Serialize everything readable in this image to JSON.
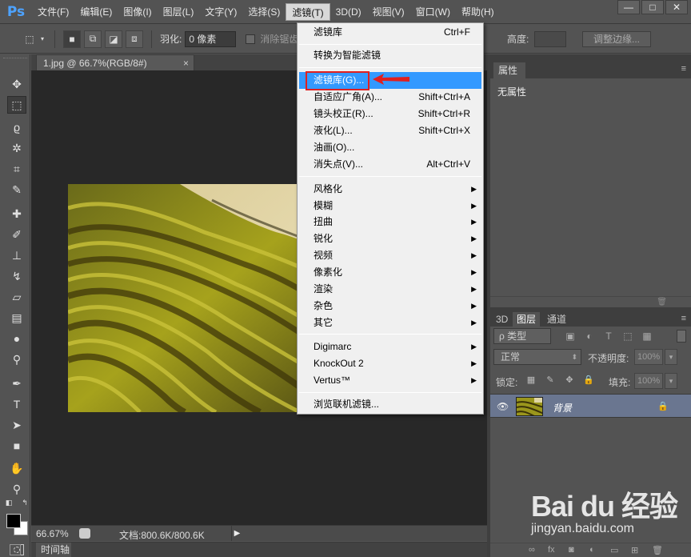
{
  "app": {
    "logo": "Ps"
  },
  "menubar": {
    "items": [
      "文件(F)",
      "编辑(E)",
      "图像(I)",
      "图层(L)",
      "文字(Y)",
      "选择(S)",
      "滤镜(T)",
      "3D(D)",
      "视图(V)",
      "窗口(W)",
      "帮助(H)"
    ],
    "active_index": 6,
    "window_controls": [
      "—",
      "□",
      "✕"
    ]
  },
  "options": {
    "feather_label": "羽化:",
    "feather_value": "0 像素",
    "antialias_label": "消除锯齿",
    "height_label": "高度:",
    "refine_edge": "调整边缘..."
  },
  "document": {
    "tab_title": "1.jpg @ 66.7%(RGB/8#)",
    "tab_close": "×",
    "zoom": "66.67%",
    "doc_info": "文档:800.6K/800.6K",
    "timeline_tab": "时间轴"
  },
  "filter_menu": {
    "items": [
      {
        "label": "滤镜库",
        "shortcut": "Ctrl+F"
      },
      {
        "label": "转换为智能滤镜",
        "shortcut": ""
      },
      {
        "label": "滤镜库(G)...",
        "shortcut": "",
        "highlighted": true
      },
      {
        "label": "自适应广角(A)...",
        "shortcut": "Shift+Ctrl+A"
      },
      {
        "label": "镜头校正(R)...",
        "shortcut": "Shift+Ctrl+R"
      },
      {
        "label": "液化(L)...",
        "shortcut": "Shift+Ctrl+X"
      },
      {
        "label": "油画(O)...",
        "shortcut": ""
      },
      {
        "label": "消失点(V)...",
        "shortcut": "Alt+Ctrl+V"
      },
      {
        "label": "风格化",
        "submenu": true
      },
      {
        "label": "模糊",
        "submenu": true
      },
      {
        "label": "扭曲",
        "submenu": true
      },
      {
        "label": "锐化",
        "submenu": true
      },
      {
        "label": "视频",
        "submenu": true
      },
      {
        "label": "像素化",
        "submenu": true
      },
      {
        "label": "渲染",
        "submenu": true
      },
      {
        "label": "杂色",
        "submenu": true
      },
      {
        "label": "其它",
        "submenu": true
      },
      {
        "label": "Digimarc",
        "submenu": true
      },
      {
        "label": "KnockOut 2",
        "submenu": true
      },
      {
        "label": "Vertus™",
        "submenu": true
      },
      {
        "label": "浏览联机滤镜...",
        "shortcut": ""
      }
    ]
  },
  "properties_panel": {
    "tab": "属性",
    "empty_text": "无属性"
  },
  "layers_panel": {
    "tabs": [
      "3D",
      "图层",
      "通道"
    ],
    "active_tab": 1,
    "filter_kind": "ρ 类型",
    "blend_mode": "正常",
    "opacity_label": "不透明度:",
    "opacity_value": "100%",
    "lock_label": "锁定:",
    "fill_label": "填充:",
    "fill_value": "100%",
    "layer_name": "背景"
  },
  "watermark": {
    "logo": "Bai du 经验",
    "url": "jingyan.baidu.com"
  },
  "colors": {
    "menu_highlight": "#3399ff",
    "annotation_red": "#e02020",
    "layer_selected": "#6a7690"
  }
}
